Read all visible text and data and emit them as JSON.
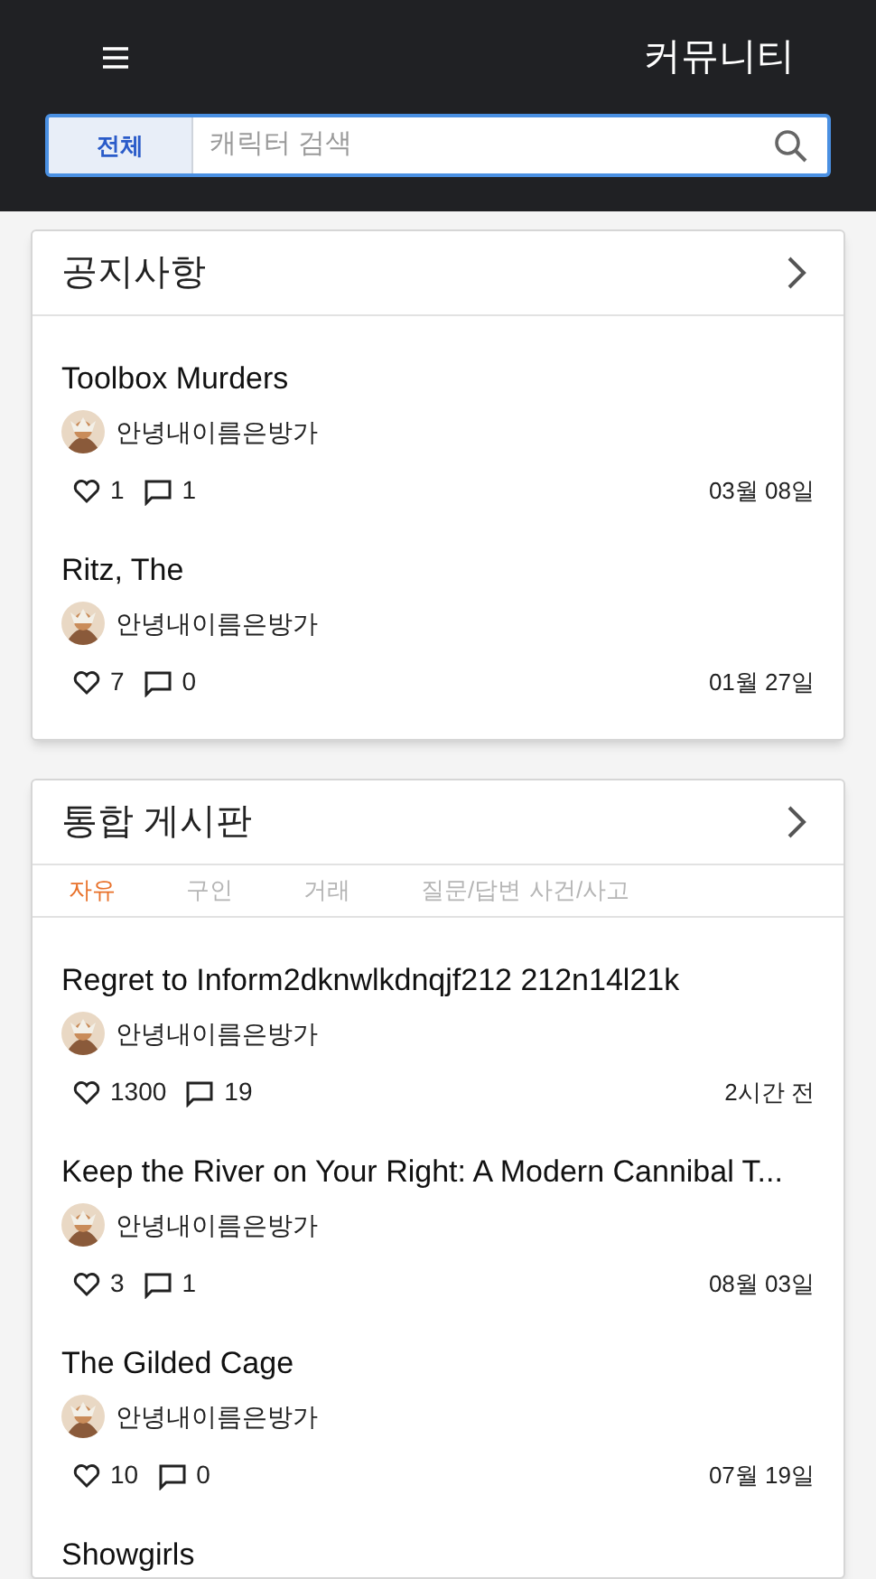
{
  "header": {
    "title": "커뮤니티"
  },
  "search": {
    "scope": "전체",
    "placeholder": "캐릭터 검색"
  },
  "notice": {
    "title": "공지사항",
    "posts": [
      {
        "title": "Toolbox Murders",
        "author": "안녕내이름은방가",
        "likes": "1",
        "comments": "1",
        "date": "03월 08일"
      },
      {
        "title": "Ritz, The",
        "author": "안녕내이름은방가",
        "likes": "7",
        "comments": "0",
        "date": "01월 27일"
      }
    ]
  },
  "board": {
    "title": "통합 게시판",
    "tabs": [
      {
        "label": "자유",
        "selected": true
      },
      {
        "label": "구인",
        "selected": false
      },
      {
        "label": "거래",
        "selected": false
      },
      {
        "label": "질문/답변",
        "selected": false
      },
      {
        "label": "사건/사고",
        "selected": false
      }
    ],
    "posts": [
      {
        "title": "Regret to Inform2dknwlkdnqjf212 212n14l21k",
        "author": "안녕내이름은방가",
        "likes": "1300",
        "comments": "19",
        "date": "2시간 전"
      },
      {
        "title": "Keep the River on Your Right: A Modern Cannibal T...",
        "author": "안녕내이름은방가",
        "likes": "3",
        "comments": "1",
        "date": "08월 03일"
      },
      {
        "title": "The Gilded Cage",
        "author": "안녕내이름은방가",
        "likes": "10",
        "comments": "0",
        "date": "07월 19일"
      },
      {
        "title": "Showgirls"
      }
    ]
  }
}
